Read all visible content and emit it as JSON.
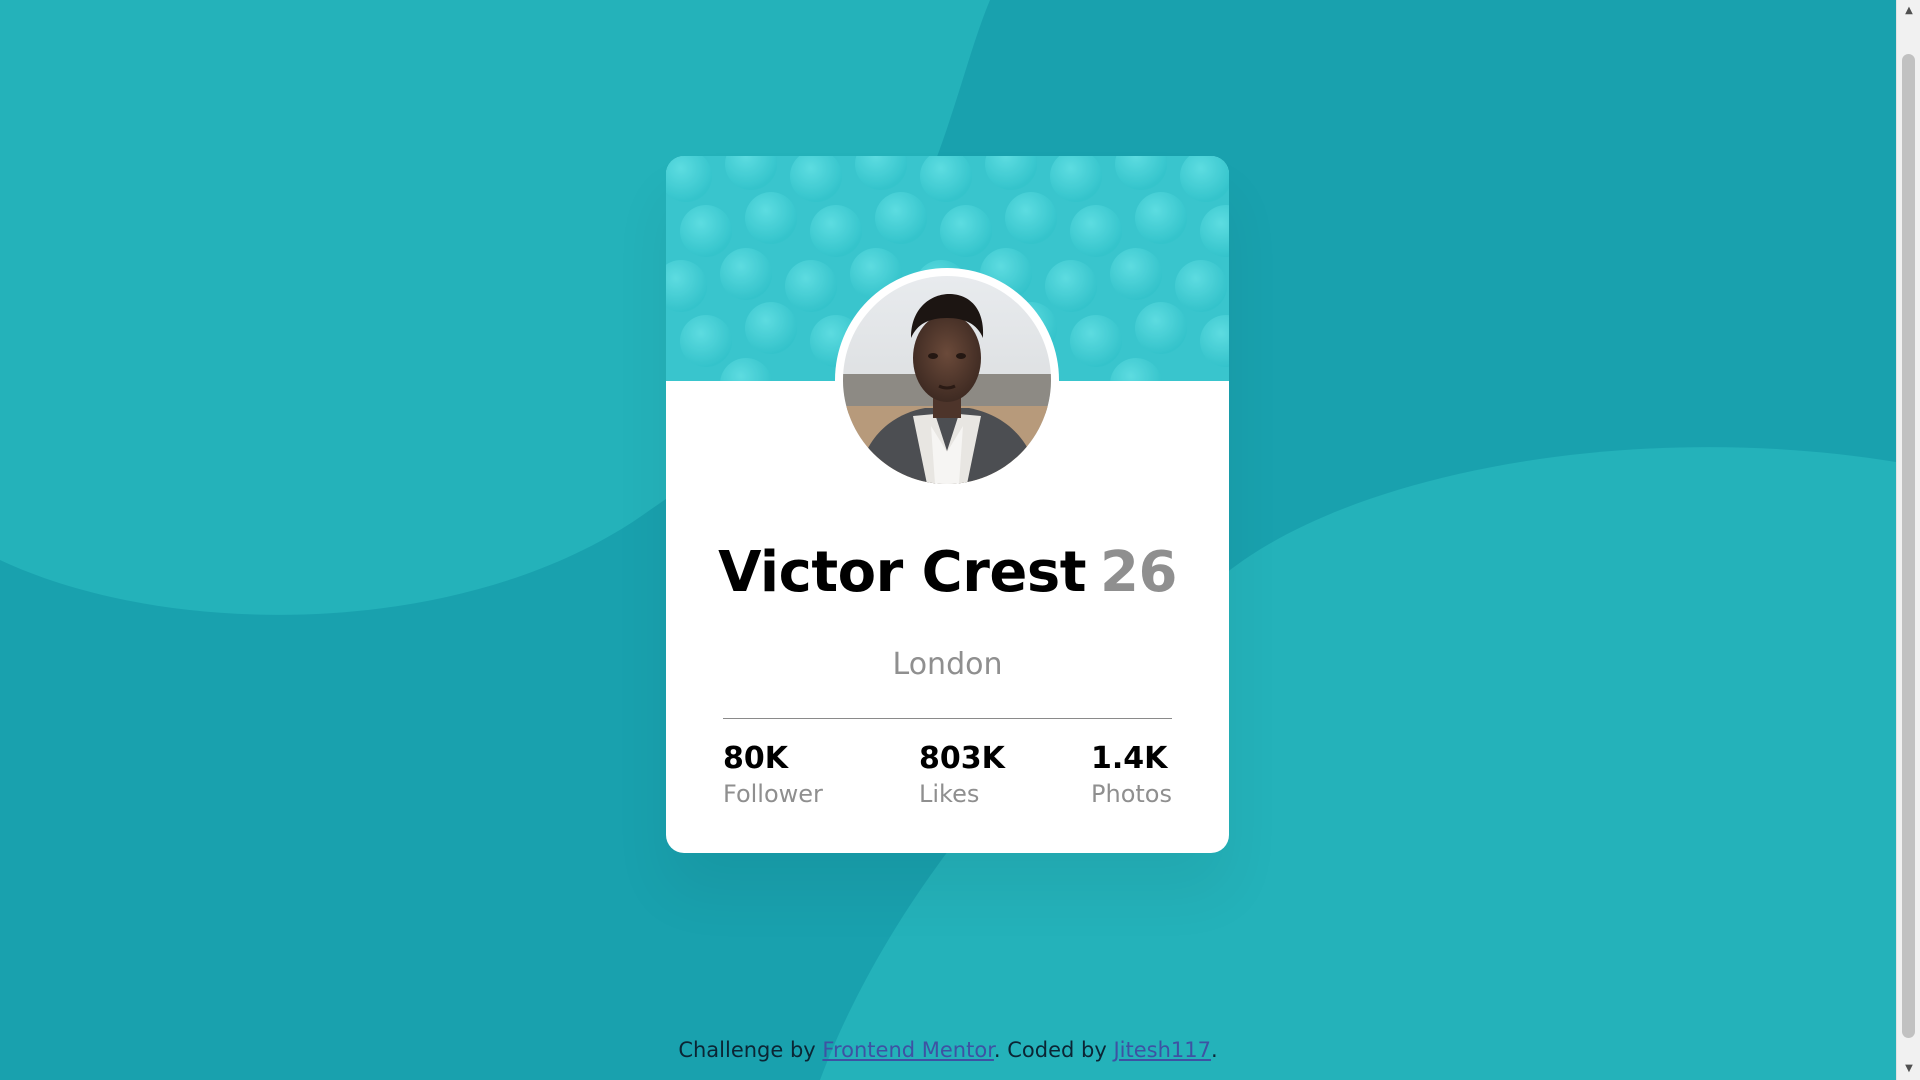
{
  "colors": {
    "background": "#19a1ae",
    "background_shape": "#23b1b9",
    "card": "#ffffff",
    "header_pattern": "#3ac7cf",
    "link": "#3e52a3",
    "muted_text": "#8f8f8f"
  },
  "profile": {
    "name": "Victor Crest",
    "age": "26",
    "location": "London",
    "avatar_icon": "profile-photo"
  },
  "stats": [
    {
      "value": "80K",
      "label": "Follower"
    },
    {
      "value": "803K",
      "label": "Likes"
    },
    {
      "value": "1.4K",
      "label": "Photos"
    }
  ],
  "footer": {
    "prefix": "Challenge by ",
    "link1": "Frontend Mentor",
    "middle": ". Coded by ",
    "link2": "Jitesh117",
    "suffix": "."
  }
}
